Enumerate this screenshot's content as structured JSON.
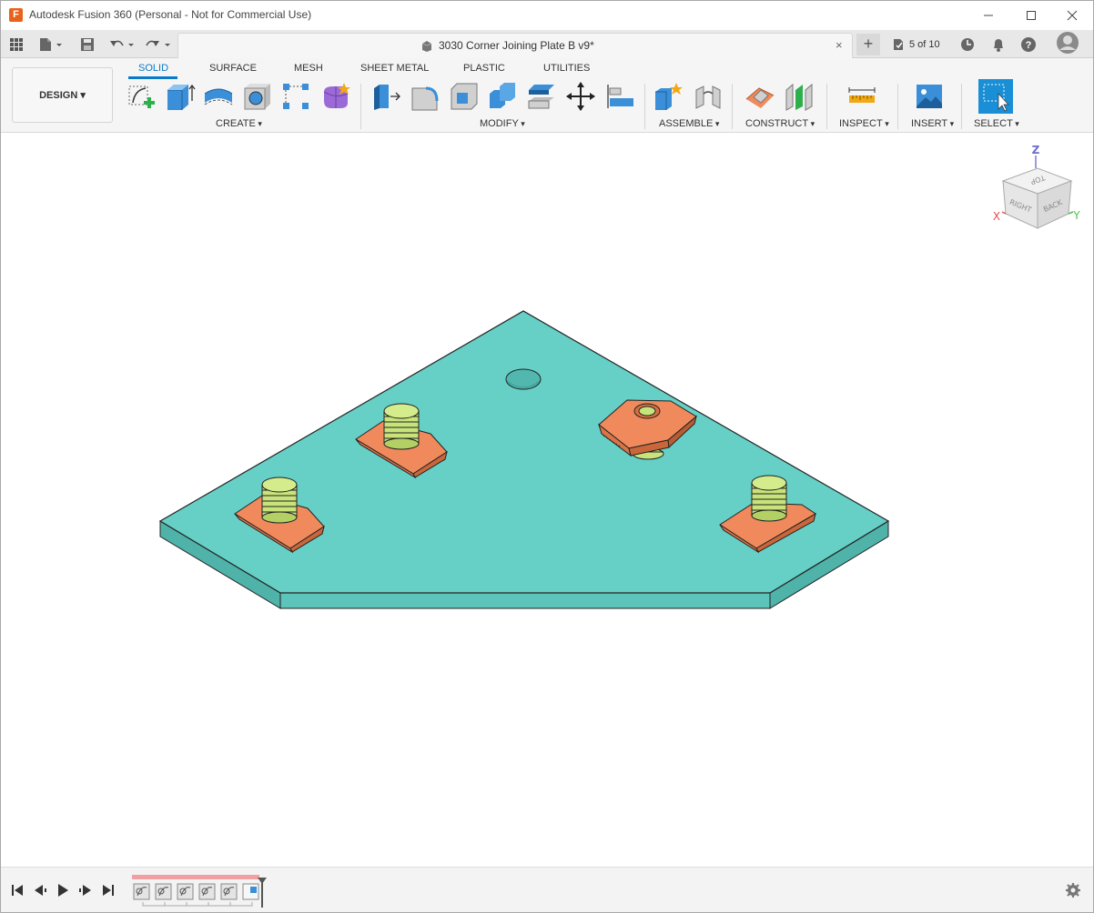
{
  "window": {
    "title": "Autodesk Fusion 360 (Personal - Not for Commercial Use)",
    "app_icon_letter": "F"
  },
  "document": {
    "title": "3030 Corner Joining Plate B v9*",
    "close_glyph": "×",
    "new_tab_glyph": "+"
  },
  "job_status": {
    "text": "5 of 10"
  },
  "workspace": {
    "label": "DESIGN ▾"
  },
  "ribbon_tabs": [
    "SOLID",
    "SURFACE",
    "MESH",
    "SHEET METAL",
    "PLASTIC",
    "UTILITIES"
  ],
  "active_tab": "SOLID",
  "groups": [
    "CREATE",
    "MODIFY",
    "ASSEMBLE",
    "CONSTRUCT",
    "INSPECT",
    "INSERT",
    "SELECT"
  ],
  "viewcube": {
    "faces": [
      "TOP",
      "RIGHT",
      "BACK"
    ],
    "axes": [
      "Z",
      "X",
      "Y"
    ]
  },
  "colors": {
    "accent": "#0b79c9",
    "plate": "#66cfc6",
    "plate_side": "#4fb3aa",
    "nut": "#f08a5d",
    "screw": "#c8e37a",
    "select_tool": "#1a8fd6",
    "timeline_marker": "#f0a0a0"
  },
  "timeline": {
    "feature_count": 5
  }
}
